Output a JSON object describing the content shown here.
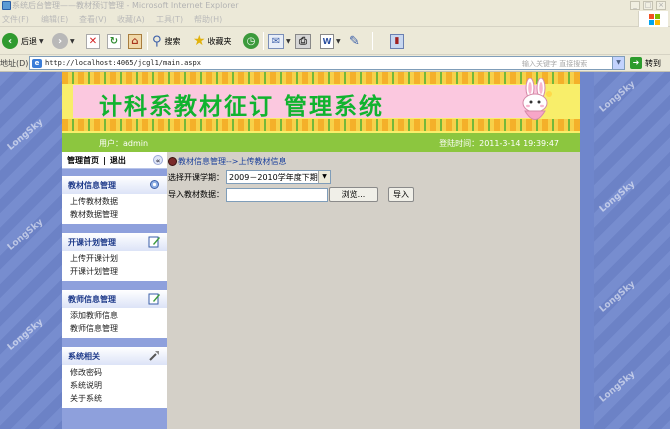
{
  "window": {
    "title": "系统后台管理——教材预订管理 - Microsoft Internet Explorer",
    "min_icon": "minimize-icon",
    "max_icon": "maximize-icon",
    "close_icon": "close-icon"
  },
  "menu": [
    "文件(F)",
    "编辑(E)",
    "查看(V)",
    "收藏(A)",
    "工具(T)",
    "帮助(H)"
  ],
  "toolbar": {
    "back_label": "后退",
    "search_label": "搜索",
    "favorites_label": "收藏夹"
  },
  "address": {
    "label": "地址(D)",
    "url": "http://localhost:4065/jcgl1/main.aspx",
    "search_hint": "输入关键字 直接搜索",
    "go_label": "转到"
  },
  "watermark": "LongSky",
  "banner": {
    "title": "计科系教材征订 管理系统"
  },
  "status": {
    "user": "用户：admin",
    "login_time": "登陆时间：2011-3-14 19:39:47"
  },
  "sidebar": {
    "home": "管理首页",
    "divider": "|",
    "logout": "退出",
    "collapse": "«",
    "groups": [
      {
        "title": "教材信息管理",
        "items": [
          "上传教材数据",
          "教材数据管理"
        ]
      },
      {
        "title": "开课计划管理",
        "items": [
          "上传开课计划",
          "开课计划管理"
        ]
      },
      {
        "title": "教师信息管理",
        "items": [
          "添加教师信息",
          "教师信息管理"
        ]
      },
      {
        "title": "系统相关",
        "items": [
          "修改密码",
          "系统说明",
          "关于系统"
        ]
      }
    ]
  },
  "content": {
    "breadcrumb": "教材信息管理-->上传教材信息",
    "semester_label": "选择开课学期：",
    "semester_value": "2009－2010学年度下期",
    "import_label": "导入教材数据：",
    "browse_label": "浏览...",
    "import_button": "导入"
  },
  "colors": {
    "banner_title": "#11b32f",
    "greenbar": "#8cc63f",
    "sidebar_bg": "#8ea0dc",
    "page_bg": "#6f86cc"
  }
}
